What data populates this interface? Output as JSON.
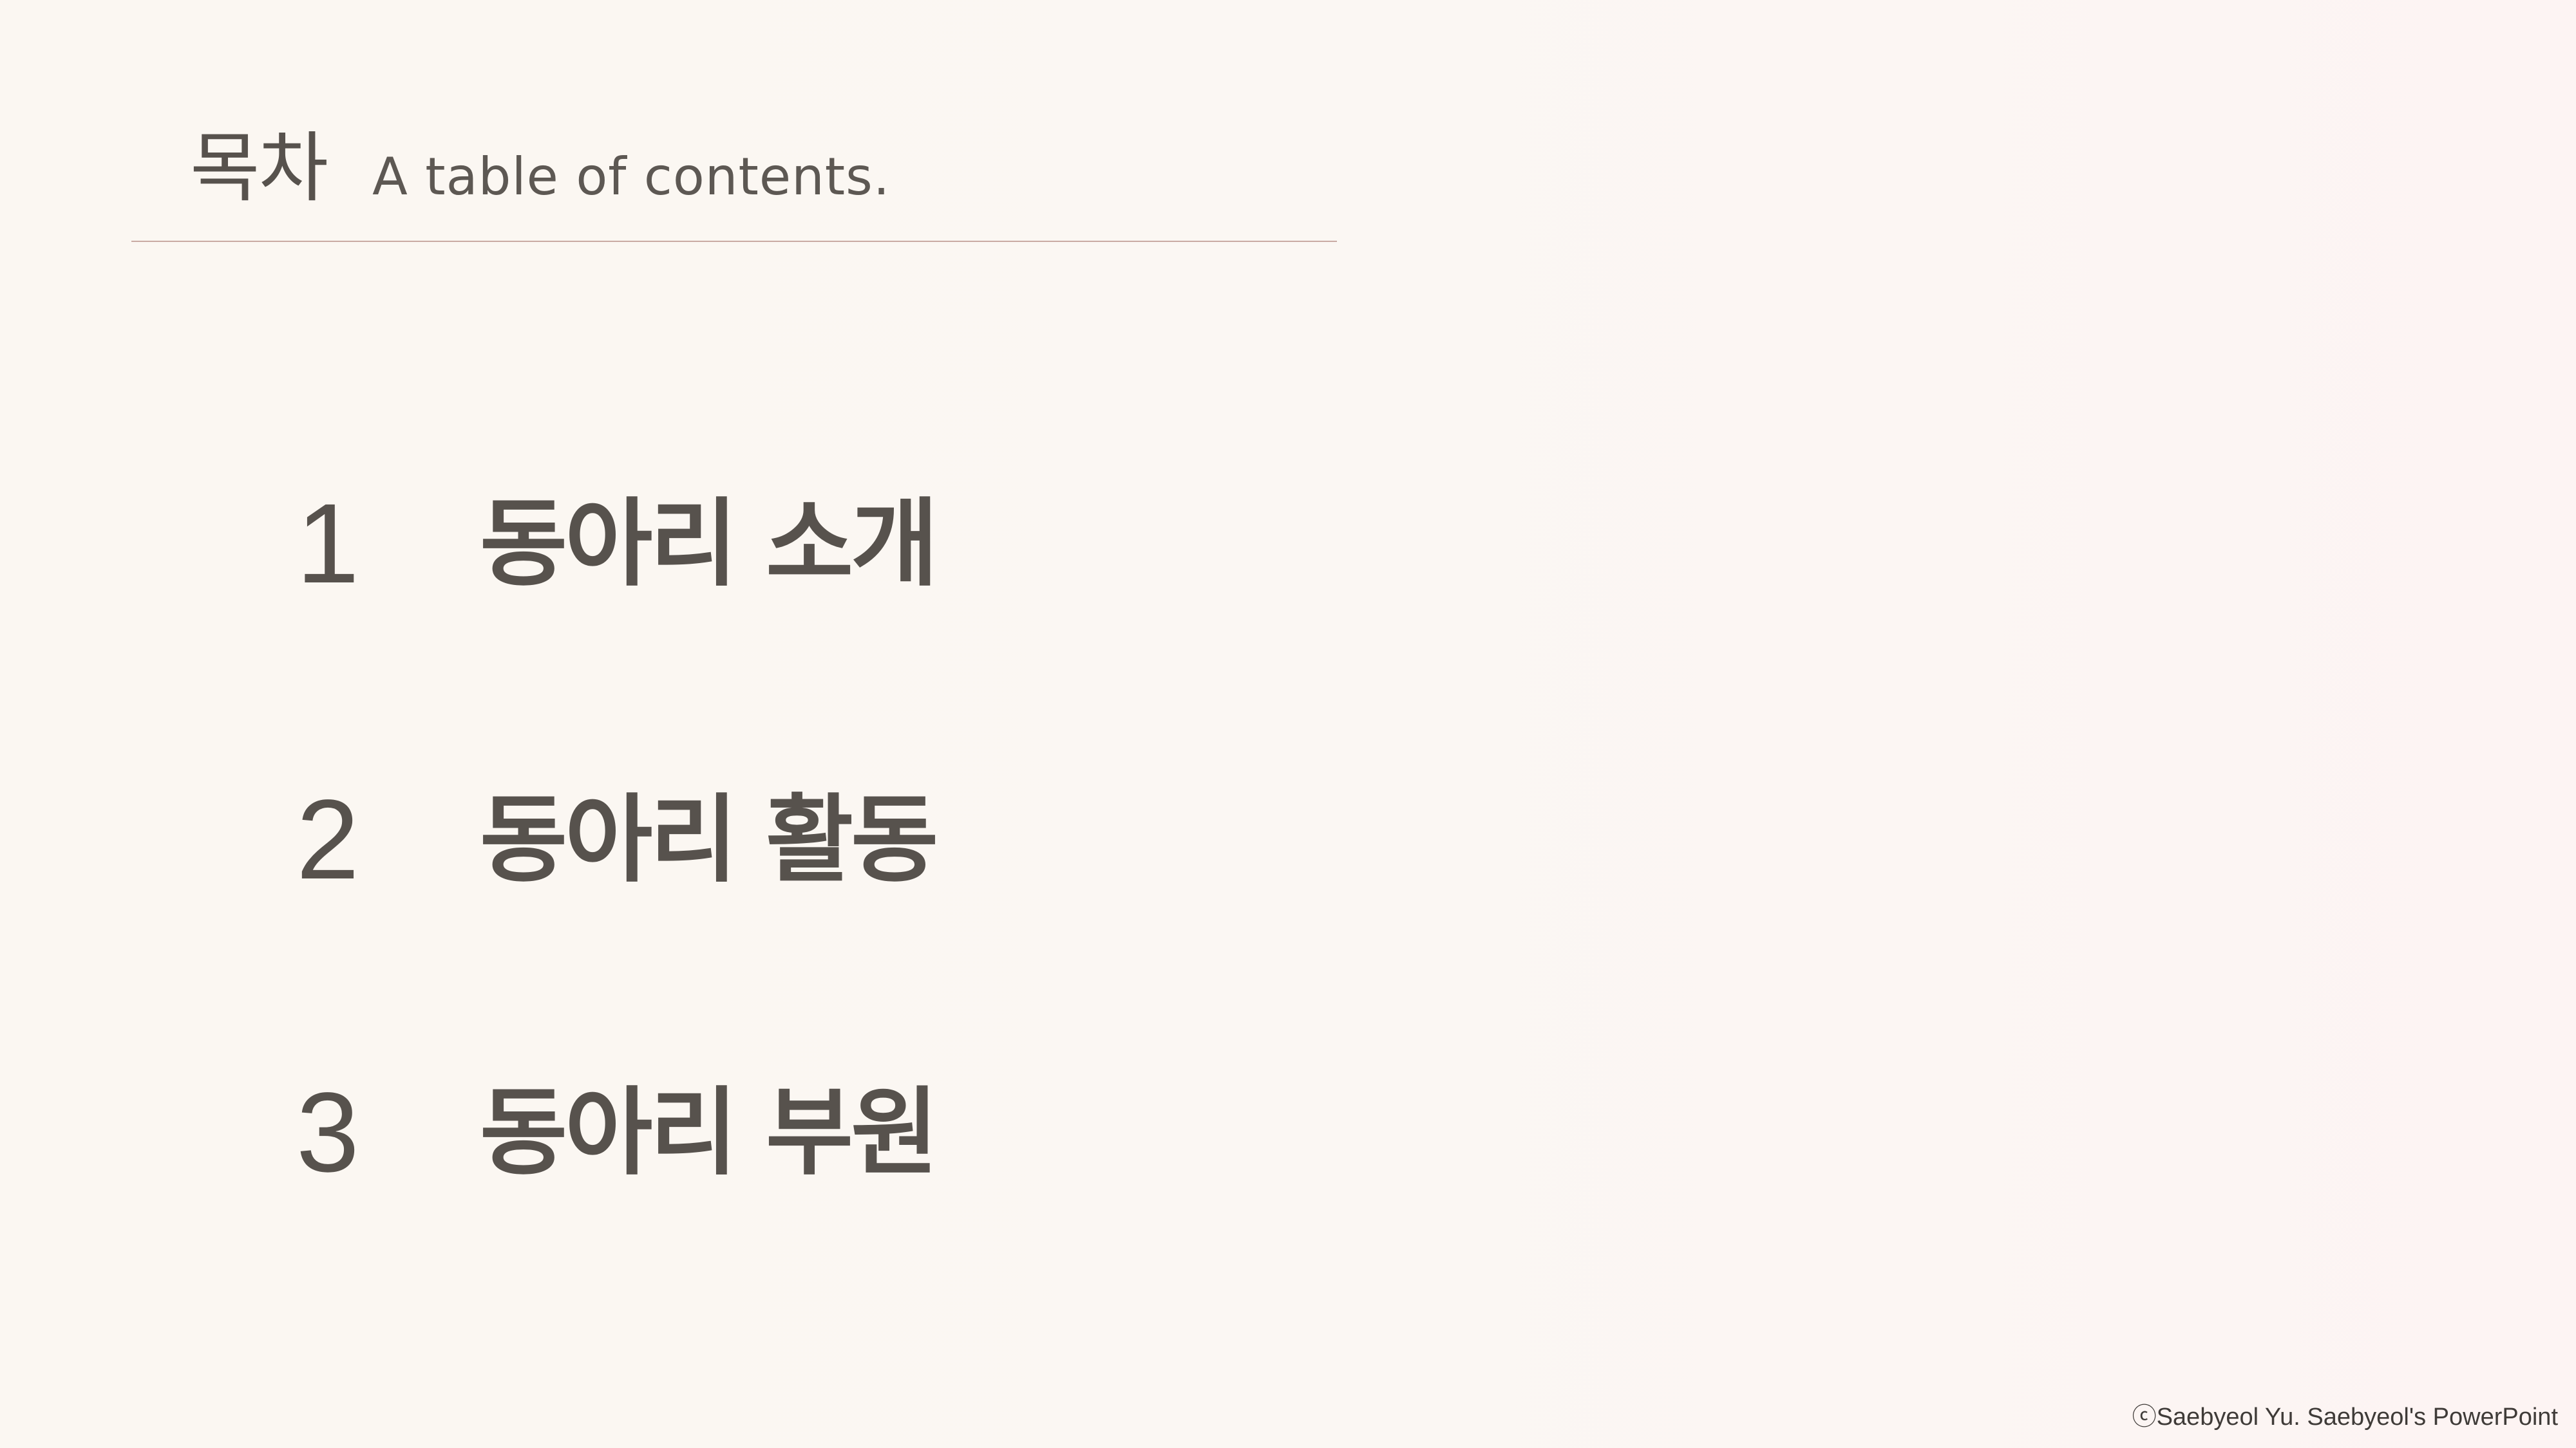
{
  "header": {
    "title_ko": "목차",
    "title_en": "A table of contents."
  },
  "toc": {
    "items": [
      {
        "number": "1",
        "label": "동아리 소개"
      },
      {
        "number": "2",
        "label": "동아리 활동"
      },
      {
        "number": "3",
        "label": "동아리 부원"
      }
    ]
  },
  "footer": {
    "copyright": "ⓒSaebyeol Yu. Saebyeol's PowerPoint"
  },
  "colors": {
    "background": "#fbf7f3",
    "text": "#57524d",
    "rule": "#c9aaa3"
  }
}
